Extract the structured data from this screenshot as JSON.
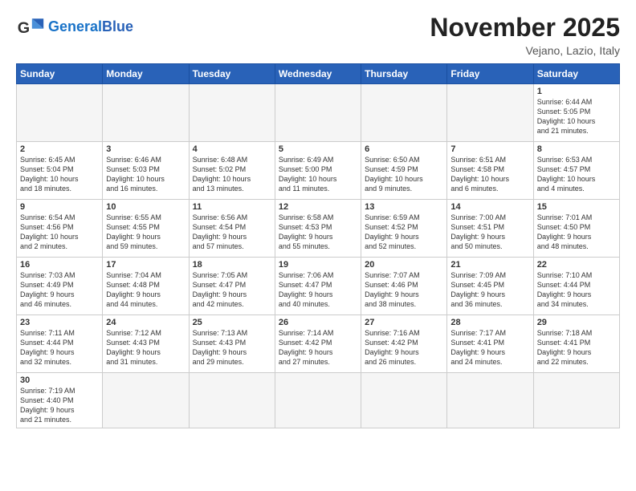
{
  "header": {
    "logo_general": "General",
    "logo_blue": "Blue",
    "title": "November 2025",
    "subtitle": "Vejano, Lazio, Italy"
  },
  "weekdays": [
    "Sunday",
    "Monday",
    "Tuesday",
    "Wednesday",
    "Thursday",
    "Friday",
    "Saturday"
  ],
  "weeks": [
    [
      {
        "day": "",
        "info": ""
      },
      {
        "day": "",
        "info": ""
      },
      {
        "day": "",
        "info": ""
      },
      {
        "day": "",
        "info": ""
      },
      {
        "day": "",
        "info": ""
      },
      {
        "day": "",
        "info": ""
      },
      {
        "day": "1",
        "info": "Sunrise: 6:44 AM\nSunset: 5:05 PM\nDaylight: 10 hours\nand 21 minutes."
      }
    ],
    [
      {
        "day": "2",
        "info": "Sunrise: 6:45 AM\nSunset: 5:04 PM\nDaylight: 10 hours\nand 18 minutes."
      },
      {
        "day": "3",
        "info": "Sunrise: 6:46 AM\nSunset: 5:03 PM\nDaylight: 10 hours\nand 16 minutes."
      },
      {
        "day": "4",
        "info": "Sunrise: 6:48 AM\nSunset: 5:02 PM\nDaylight: 10 hours\nand 13 minutes."
      },
      {
        "day": "5",
        "info": "Sunrise: 6:49 AM\nSunset: 5:00 PM\nDaylight: 10 hours\nand 11 minutes."
      },
      {
        "day": "6",
        "info": "Sunrise: 6:50 AM\nSunset: 4:59 PM\nDaylight: 10 hours\nand 9 minutes."
      },
      {
        "day": "7",
        "info": "Sunrise: 6:51 AM\nSunset: 4:58 PM\nDaylight: 10 hours\nand 6 minutes."
      },
      {
        "day": "8",
        "info": "Sunrise: 6:53 AM\nSunset: 4:57 PM\nDaylight: 10 hours\nand 4 minutes."
      }
    ],
    [
      {
        "day": "9",
        "info": "Sunrise: 6:54 AM\nSunset: 4:56 PM\nDaylight: 10 hours\nand 2 minutes."
      },
      {
        "day": "10",
        "info": "Sunrise: 6:55 AM\nSunset: 4:55 PM\nDaylight: 9 hours\nand 59 minutes."
      },
      {
        "day": "11",
        "info": "Sunrise: 6:56 AM\nSunset: 4:54 PM\nDaylight: 9 hours\nand 57 minutes."
      },
      {
        "day": "12",
        "info": "Sunrise: 6:58 AM\nSunset: 4:53 PM\nDaylight: 9 hours\nand 55 minutes."
      },
      {
        "day": "13",
        "info": "Sunrise: 6:59 AM\nSunset: 4:52 PM\nDaylight: 9 hours\nand 52 minutes."
      },
      {
        "day": "14",
        "info": "Sunrise: 7:00 AM\nSunset: 4:51 PM\nDaylight: 9 hours\nand 50 minutes."
      },
      {
        "day": "15",
        "info": "Sunrise: 7:01 AM\nSunset: 4:50 PM\nDaylight: 9 hours\nand 48 minutes."
      }
    ],
    [
      {
        "day": "16",
        "info": "Sunrise: 7:03 AM\nSunset: 4:49 PM\nDaylight: 9 hours\nand 46 minutes."
      },
      {
        "day": "17",
        "info": "Sunrise: 7:04 AM\nSunset: 4:48 PM\nDaylight: 9 hours\nand 44 minutes."
      },
      {
        "day": "18",
        "info": "Sunrise: 7:05 AM\nSunset: 4:47 PM\nDaylight: 9 hours\nand 42 minutes."
      },
      {
        "day": "19",
        "info": "Sunrise: 7:06 AM\nSunset: 4:47 PM\nDaylight: 9 hours\nand 40 minutes."
      },
      {
        "day": "20",
        "info": "Sunrise: 7:07 AM\nSunset: 4:46 PM\nDaylight: 9 hours\nand 38 minutes."
      },
      {
        "day": "21",
        "info": "Sunrise: 7:09 AM\nSunset: 4:45 PM\nDaylight: 9 hours\nand 36 minutes."
      },
      {
        "day": "22",
        "info": "Sunrise: 7:10 AM\nSunset: 4:44 PM\nDaylight: 9 hours\nand 34 minutes."
      }
    ],
    [
      {
        "day": "23",
        "info": "Sunrise: 7:11 AM\nSunset: 4:44 PM\nDaylight: 9 hours\nand 32 minutes."
      },
      {
        "day": "24",
        "info": "Sunrise: 7:12 AM\nSunset: 4:43 PM\nDaylight: 9 hours\nand 31 minutes."
      },
      {
        "day": "25",
        "info": "Sunrise: 7:13 AM\nSunset: 4:43 PM\nDaylight: 9 hours\nand 29 minutes."
      },
      {
        "day": "26",
        "info": "Sunrise: 7:14 AM\nSunset: 4:42 PM\nDaylight: 9 hours\nand 27 minutes."
      },
      {
        "day": "27",
        "info": "Sunrise: 7:16 AM\nSunset: 4:42 PM\nDaylight: 9 hours\nand 26 minutes."
      },
      {
        "day": "28",
        "info": "Sunrise: 7:17 AM\nSunset: 4:41 PM\nDaylight: 9 hours\nand 24 minutes."
      },
      {
        "day": "29",
        "info": "Sunrise: 7:18 AM\nSunset: 4:41 PM\nDaylight: 9 hours\nand 22 minutes."
      }
    ],
    [
      {
        "day": "30",
        "info": "Sunrise: 7:19 AM\nSunset: 4:40 PM\nDaylight: 9 hours\nand 21 minutes."
      },
      {
        "day": "",
        "info": ""
      },
      {
        "day": "",
        "info": ""
      },
      {
        "day": "",
        "info": ""
      },
      {
        "day": "",
        "info": ""
      },
      {
        "day": "",
        "info": ""
      },
      {
        "day": "",
        "info": ""
      }
    ]
  ]
}
